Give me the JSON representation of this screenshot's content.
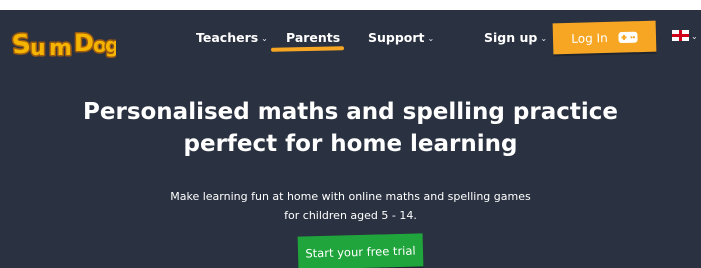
{
  "colors": {
    "background": "#2a3140",
    "accent": "#f6a623",
    "cta": "#1fa53b"
  },
  "header": {
    "logo": {
      "text": "SumDog"
    },
    "nav": [
      {
        "label": "Teachers",
        "has_dropdown": true
      },
      {
        "label": "Parents",
        "has_dropdown": false,
        "active": true
      },
      {
        "label": "Support",
        "has_dropdown": true
      },
      {
        "label": "Sign up",
        "has_dropdown": true
      }
    ],
    "login": {
      "label": "Log In",
      "icon": "gamepad-icon"
    },
    "language": {
      "icon": "uk-flag-icon",
      "has_dropdown": true
    }
  },
  "hero": {
    "headline_line1": "Personalised maths and spelling practice",
    "headline_line2": "perfect for home learning",
    "subtext_line1": "Make learning fun at home with online maths and spelling games",
    "subtext_line2": "for children aged 5 - 14.",
    "cta_label": "Start your free trial"
  }
}
